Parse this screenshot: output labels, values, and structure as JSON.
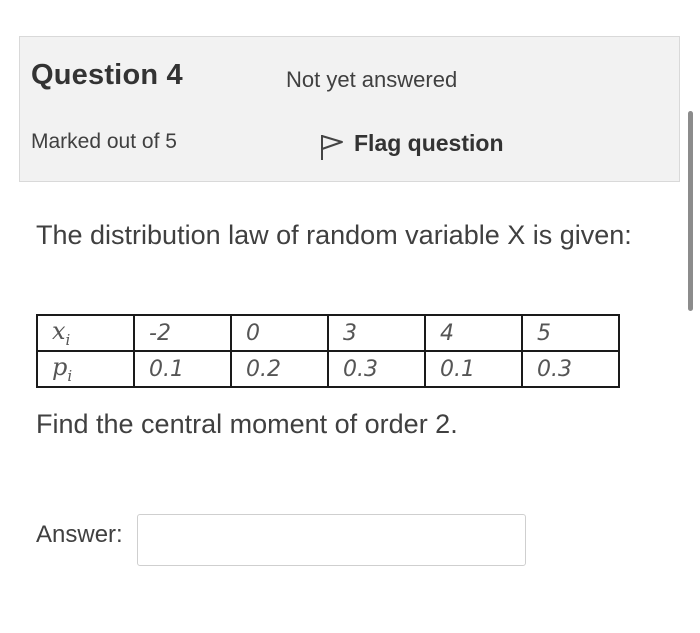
{
  "info": {
    "title": "Question 4",
    "state": "Not yet answered",
    "grade": "Marked out of 5",
    "flag_label": "Flag question",
    "flag_icon": "flag-icon"
  },
  "question": {
    "prompt": "The distribution law of random variable X is given:",
    "table": {
      "row_x": {
        "symbol": "x",
        "subscript": "i",
        "values": [
          "-2",
          "0",
          "3",
          "4",
          "5"
        ]
      },
      "row_p": {
        "symbol": "p",
        "subscript": "i",
        "values": [
          "0.1",
          "0.2",
          "0.3",
          "0.1",
          "0.3"
        ]
      }
    },
    "task": "Find the central moment of order 2."
  },
  "answer": {
    "label": "Answer:",
    "value": ""
  }
}
